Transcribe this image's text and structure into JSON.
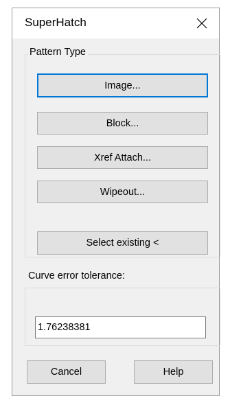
{
  "dialog": {
    "title": "SuperHatch",
    "close_icon": "close-icon"
  },
  "pattern_type": {
    "label": "Pattern Type",
    "buttons": {
      "image": "Image...",
      "block": "Block...",
      "xref_attach": "Xref Attach...",
      "wipeout": "Wipeout...",
      "select_existing": "Select existing <"
    }
  },
  "curve_error": {
    "label": "Curve error tolerance:",
    "value": "1.76238381"
  },
  "footer": {
    "cancel": "Cancel",
    "help": "Help"
  },
  "colors": {
    "dialog_bg": "#f0f0f0",
    "button_bg": "#e1e1e1",
    "default_button_border": "#0078d7"
  }
}
